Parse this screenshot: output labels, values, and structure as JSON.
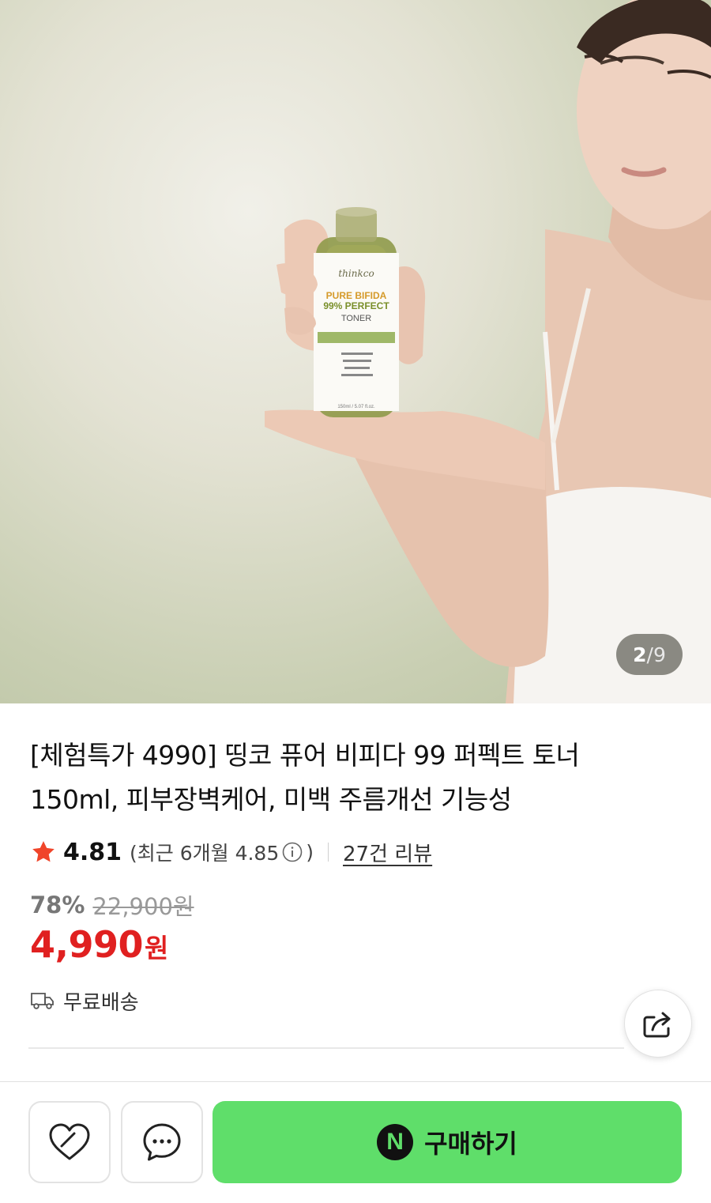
{
  "hero": {
    "alt": "Woman holding a bottle of toner",
    "bottle": {
      "brand": "thinkco",
      "line1": "PURE BIFIDA",
      "line2": "99% PERFECT",
      "line3": "TONER",
      "volume": "150ml / 5.07 fl.oz."
    },
    "counter": {
      "current": "2",
      "separator": "/",
      "total": "9"
    }
  },
  "product": {
    "title": "[체험특가 4990] 띵코 퓨어 비피다 99 퍼펙트 토너 150ml, 피부장벽케어, 미백 주름개선 기능성",
    "rating": "4.81",
    "recent_open": "(최근 6개월 4.85",
    "recent_close": ")",
    "review_link": "27건 리뷰",
    "discount_rate": "78%",
    "original_price": "22,900원",
    "sale_price": "4,990",
    "sale_unit": "원",
    "shipping": "무료배송"
  },
  "actions": {
    "buy_label": "구매하기",
    "npay_letter": "N"
  },
  "colors": {
    "sale": "#e02020",
    "star": "#f0452a",
    "buy_button": "#5fde6a"
  },
  "icons": [
    "star-icon",
    "info-icon",
    "truck-icon",
    "share-icon",
    "heart-icon",
    "chat-icon",
    "npay-icon"
  ]
}
